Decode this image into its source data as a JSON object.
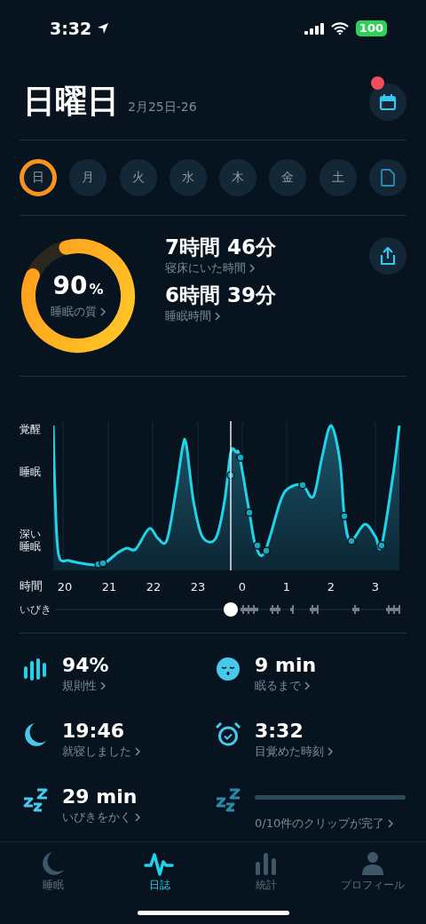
{
  "status_bar": {
    "time": "3:32",
    "battery": "100"
  },
  "header": {
    "title": "日曜日",
    "date": "2月25日-26",
    "calendar_notification": true
  },
  "days": [
    {
      "label": "日",
      "selected": true
    },
    {
      "label": "月",
      "selected": false
    },
    {
      "label": "火",
      "selected": false
    },
    {
      "label": "水",
      "selected": false
    },
    {
      "label": "木",
      "selected": false
    },
    {
      "label": "金",
      "selected": false
    },
    {
      "label": "土",
      "selected": false
    }
  ],
  "summary": {
    "quality": {
      "value": "90",
      "unit": "%",
      "label": "睡眠の質",
      "level": 0.9
    },
    "durations": [
      {
        "value": "7時間 46分",
        "label": "寝床にいた時間"
      },
      {
        "value": "6時間 39分",
        "label": "睡眠時間"
      }
    ]
  },
  "sleep_graph": {
    "y_labels": [
      "覚醒",
      "睡眠",
      "深い睡眠"
    ],
    "x_title": "時間",
    "x_labels": [
      "20",
      "21",
      "22",
      "23",
      "0",
      "1",
      "2",
      "3"
    ],
    "snore_label": "いびき"
  },
  "stats": [
    {
      "kind": "value",
      "value": "94%",
      "label": "規則性"
    },
    {
      "kind": "value",
      "value": "9 min",
      "label": "眠るまで"
    },
    {
      "kind": "value",
      "value": "19:46",
      "label": "就寝しました"
    },
    {
      "kind": "value",
      "value": "3:32",
      "label": "目覚めた時刻"
    },
    {
      "kind": "value",
      "value": "29 min",
      "label": "いびきをかく"
    },
    {
      "kind": "progress",
      "level": 0,
      "label": "0/10件のクリップが完了"
    }
  ],
  "tab_bar": [
    {
      "label": "睡眠",
      "selected": false
    },
    {
      "label": "日誌",
      "selected": true
    },
    {
      "label": "統計",
      "selected": false
    },
    {
      "label": "プロフィール",
      "selected": false
    }
  ]
}
